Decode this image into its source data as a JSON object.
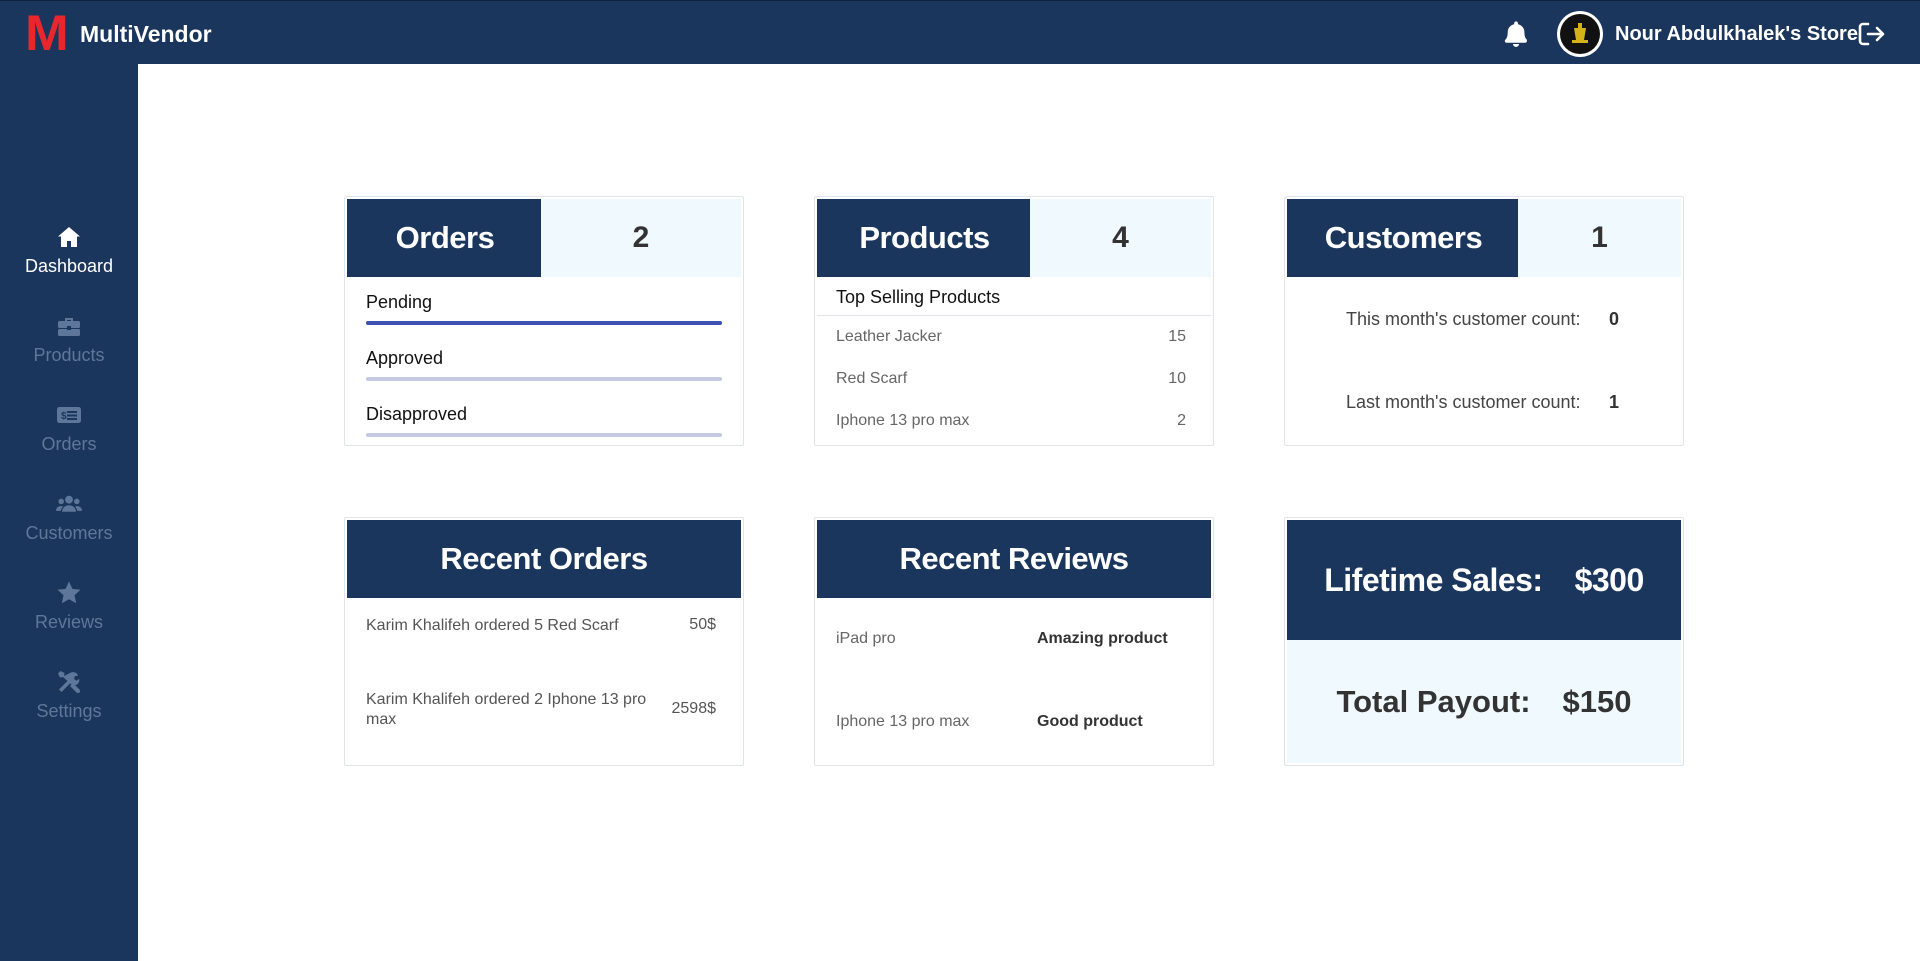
{
  "app": {
    "logo_letter": "M",
    "brand": "MultiVendor"
  },
  "header": {
    "store_name": "Nour Abdulkhalek's Store"
  },
  "sidebar": {
    "items": [
      {
        "label": "Dashboard",
        "icon": "home-icon",
        "active": true
      },
      {
        "label": "Products",
        "icon": "briefcase-icon"
      },
      {
        "label": "Orders",
        "icon": "money-bill-icon"
      },
      {
        "label": "Customers",
        "icon": "users-icon"
      },
      {
        "label": "Reviews",
        "icon": "star-icon"
      },
      {
        "label": "Settings",
        "icon": "tools-icon"
      }
    ]
  },
  "orders_card": {
    "title": "Orders",
    "count": "2",
    "statuses": [
      {
        "label": "Pending",
        "fill": 1.0
      },
      {
        "label": "Approved",
        "fill": 0
      },
      {
        "label": "Disapproved",
        "fill": 0
      }
    ]
  },
  "products_card": {
    "title": "Products",
    "count": "4",
    "top_selling_title": "Top Selling Products",
    "top_selling": [
      {
        "name": "Leather Jacker",
        "qty": "15"
      },
      {
        "name": "Red Scarf",
        "qty": "10"
      },
      {
        "name": "Iphone 13 pro max",
        "qty": "2"
      }
    ]
  },
  "customers_card": {
    "title": "Customers",
    "count": "1",
    "this_month_label": "This month's customer count:",
    "this_month_value": "0",
    "last_month_label": "Last month's customer count:",
    "last_month_value": "1"
  },
  "recent_orders": {
    "title": "Recent Orders",
    "rows": [
      {
        "text": "Karim Khalifeh ordered 5 Red Scarf",
        "amount": "50$"
      },
      {
        "text": "Karim Khalifeh ordered 2 Iphone 13 pro max",
        "amount": "2598$"
      }
    ]
  },
  "recent_reviews": {
    "title": "Recent Reviews",
    "rows": [
      {
        "product": "iPad pro",
        "review": "Amazing product"
      },
      {
        "product": "Iphone 13 pro max",
        "review": "Good product"
      }
    ]
  },
  "sales": {
    "lifetime_label": "Lifetime Sales:",
    "lifetime_value": "$300",
    "payout_label": "Total Payout:",
    "payout_value": "$150"
  },
  "colors": {
    "navy": "#1b365d",
    "logo_red": "#e8262d",
    "light_panel": "#f0f9fd",
    "progress": "#3f51b5"
  }
}
